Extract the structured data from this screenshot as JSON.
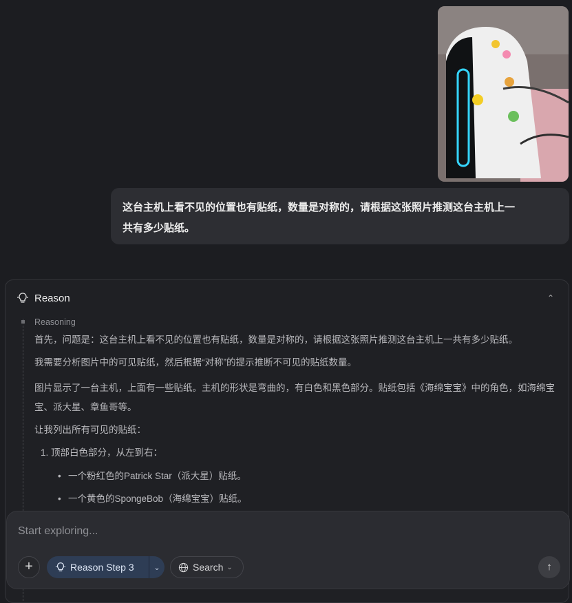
{
  "photo": {
    "alt_label": "uploaded-photo"
  },
  "user_message": {
    "line1": "这台主机上看不见的位置也有贴纸，数量是对称的，请根据这张照片推测这台主机上一",
    "line2": "共有多少贴纸。"
  },
  "reason_panel": {
    "title": "Reason",
    "step_label": "Reasoning",
    "paragraphs": [
      "首先，问题是：这台主机上看不见的位置也有贴纸，数量是对称的，请根据这张照片推测这台主机上一共有多少贴纸。",
      "我需要分析图片中的可见贴纸，然后根据“对称”的提示推断不可见的贴纸数量。",
      "图片显示了一台主机，上面有一些贴纸。主机的形状是弯曲的，有白色和黑色部分。贴纸包括《海绵宝宝》中的角色，如海绵宝宝、派大星、章鱼哥等。",
      "让我列出所有可见的贴纸："
    ],
    "ordered": [
      {
        "num": "1.",
        "text": "顶部白色部分，从左到右："
      }
    ],
    "bullets": [
      "一个粉红色的Patrick Star（派大星）贴纸。",
      "一个黄色的SpongeBob（海绵宝宝）贴纸。"
    ]
  },
  "composer": {
    "placeholder": "Start exploring...",
    "plus_label": "+",
    "reason_label": "Reason Step 3",
    "search_label": "Search",
    "send_icon": "arrow-up-icon"
  },
  "colors": {
    "background": "#1c1d21",
    "bubble": "#2d2e33",
    "reason_button": "#2e3d55"
  }
}
